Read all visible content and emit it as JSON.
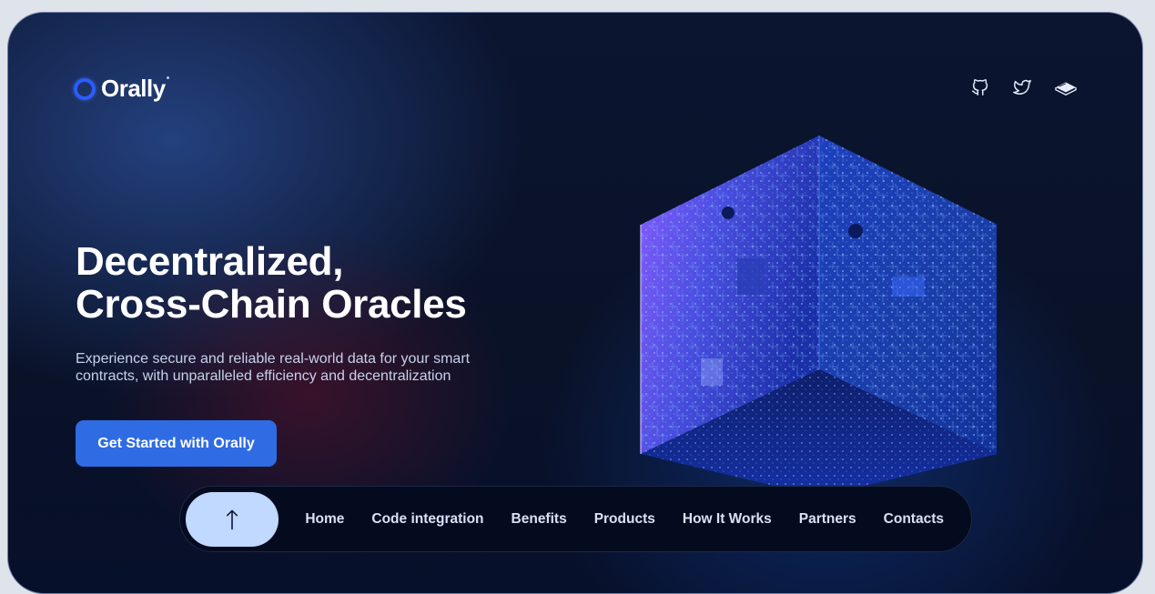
{
  "brand": {
    "name": "Orally",
    "accent": "#2a5cff"
  },
  "socials": [
    {
      "name": "GitHub",
      "icon": "github-icon"
    },
    {
      "name": "Twitter",
      "icon": "twitter-icon"
    },
    {
      "name": "Docs",
      "icon": "book-icon"
    }
  ],
  "hero": {
    "headline_line1": "Decentralized,",
    "headline_line2": "Cross-Chain Oracles",
    "subtitle": "Experience secure and reliable real-world data for your smart contracts, with unparalleled efficiency and decentralization",
    "cta_label": "Get Started with Orally",
    "cta_color": "#2f6be3"
  },
  "nav": {
    "up_icon": "arrow-up-icon",
    "items": [
      "Home",
      "Code integration",
      "Benefits",
      "Products",
      "How It Works",
      "Partners",
      "Contacts"
    ]
  }
}
